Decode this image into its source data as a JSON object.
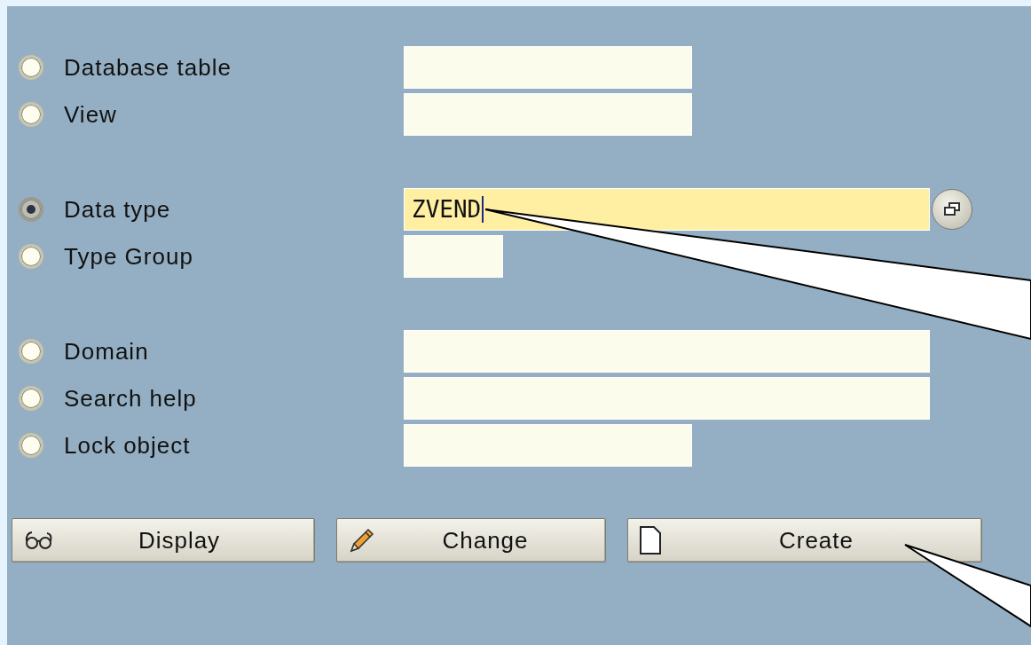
{
  "groups": [
    [
      {
        "kind": "radio",
        "label": "Database table",
        "selected": false,
        "field": {
          "focused": false
        }
      },
      {
        "kind": "radio",
        "label": "View",
        "selected": false,
        "field": {
          "focused": false
        }
      }
    ],
    [
      {
        "kind": "radio",
        "label": "Data type",
        "selected": true,
        "field": {
          "value": "ZVEND",
          "focused": true,
          "value_help": true
        }
      },
      {
        "kind": "radio",
        "label": "Type Group",
        "selected": false,
        "field": {
          "focused": false
        }
      }
    ],
    [
      {
        "kind": "radio",
        "label": "Domain",
        "selected": false,
        "field": {
          "focused": false
        }
      },
      {
        "kind": "radio",
        "label": "Search help",
        "selected": false,
        "field": {
          "focused": false
        }
      },
      {
        "kind": "radio",
        "label": "Lock object",
        "selected": false,
        "field": {
          "focused": false
        }
      }
    ]
  ],
  "buttons": [
    {
      "kind": "display",
      "label": "Display"
    },
    {
      "kind": "change",
      "label": "Change"
    },
    {
      "kind": "create",
      "label": "Create"
    }
  ]
}
